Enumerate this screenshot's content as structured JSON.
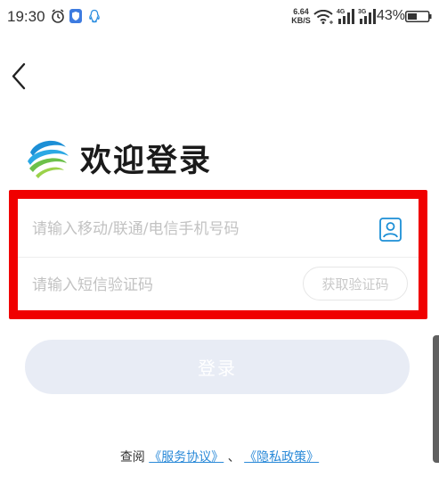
{
  "status_bar": {
    "time": "19:30",
    "net_speed_value": "6.64",
    "net_speed_unit": "KB/S",
    "signal1_label": "4G",
    "signal2_label": "3G",
    "battery": "43%",
    "icons": [
      "alarm-icon",
      "shield-icon",
      "qq-icon",
      "wifi-icon",
      "signal-icon",
      "battery-icon"
    ]
  },
  "header": {
    "back_icon": "chevron-left-icon",
    "title": "欢迎登录"
  },
  "form": {
    "phone_placeholder": "请输入移动/联通/电信手机号码",
    "phone_value": "",
    "code_placeholder": "请输入短信验证码",
    "code_value": "",
    "get_code_label": "获取验证码"
  },
  "login_button_label": "登录",
  "agreement": {
    "prefix": "查阅",
    "service_link": "《服务协议》",
    "separator": "、",
    "privacy_link": "《隐私政策》"
  },
  "colors": {
    "highlight_border": "#f00000",
    "link": "#2b8ad8",
    "login_bg": "#e8ecf5",
    "accent": "#1c8fd6"
  }
}
